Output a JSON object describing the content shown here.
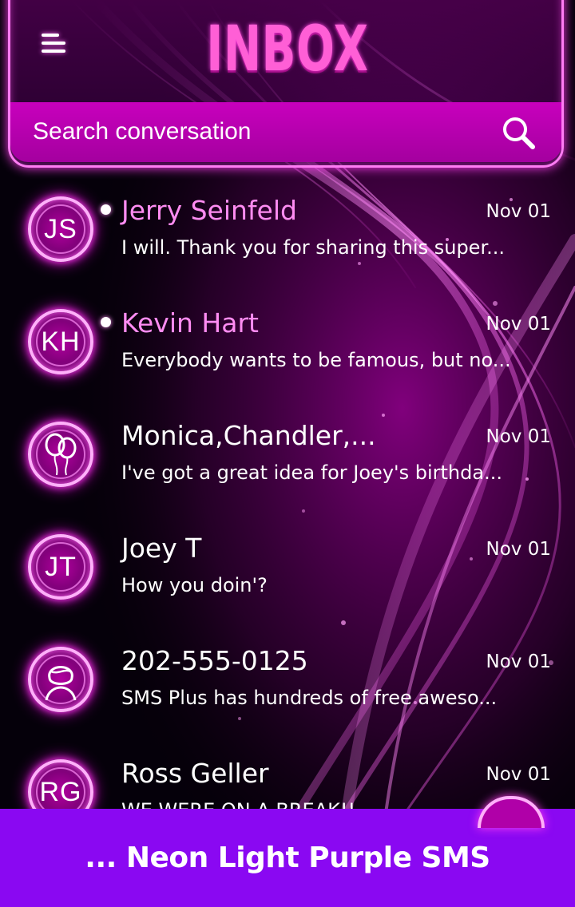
{
  "app": {
    "title": "INBOX",
    "accent_color": "#ff5fd6",
    "search_bar_color": "#c800bd",
    "banner_color": "#8a08f2"
  },
  "header": {
    "menu_icon": "hamburger-menu-icon",
    "search": {
      "placeholder": "Search conversation",
      "icon": "search-icon"
    }
  },
  "conversations": [
    {
      "initials": "JS",
      "avatar_icon": "",
      "name": "Jerry Seinfeld",
      "date": "Nov 01",
      "snippet": "I will. Thank you for sharing this super...",
      "unread": true
    },
    {
      "initials": "KH",
      "avatar_icon": "",
      "name": "Kevin Hart",
      "date": "Nov 01",
      "snippet": "Everybody wants to be famous, but no...",
      "unread": true
    },
    {
      "initials": "",
      "avatar_icon": "balloons-icon",
      "name": "Monica,Chandler,...",
      "date": "Nov 01",
      "snippet": "I've got a great idea for Joey's birthda...",
      "unread": false
    },
    {
      "initials": "JT",
      "avatar_icon": "",
      "name": "Joey T",
      "date": "Nov 01",
      "snippet": "How you doin'?",
      "unread": false
    },
    {
      "initials": "",
      "avatar_icon": "person-icon",
      "name": "202-555-0125",
      "date": "Nov 01",
      "snippet": "SMS Plus has hundreds of free aweso...",
      "unread": false
    },
    {
      "initials": "RG",
      "avatar_icon": "",
      "name": "Ross Geller",
      "date": "Nov 01",
      "snippet": "WE WERE ON A BREAK!!",
      "unread": false
    }
  ],
  "banner": {
    "text": "... Neon Light Purple SMS"
  }
}
